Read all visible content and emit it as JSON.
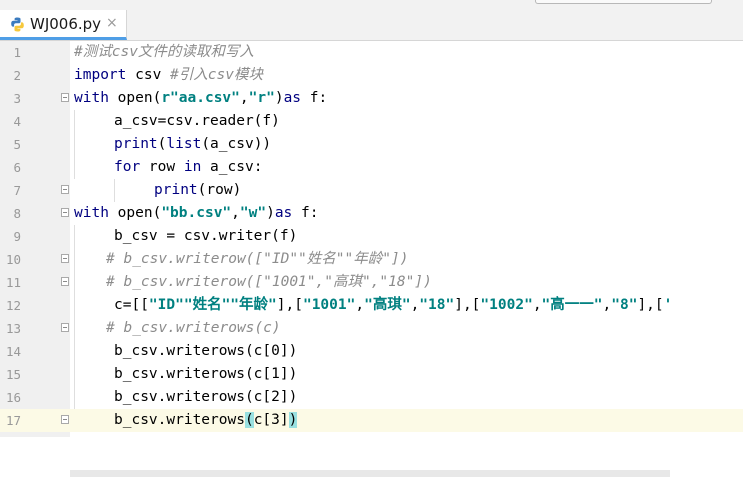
{
  "tab": {
    "filename": "WJ006.py",
    "close": "×"
  },
  "lines": [
    {
      "n": "1",
      "segs": [
        {
          "t": "#测试csv文件的读取和写入",
          "c": "cm"
        }
      ]
    },
    {
      "n": "2",
      "segs": [
        {
          "t": "import",
          "c": "kw"
        },
        {
          "t": " csv ",
          "c": ""
        },
        {
          "t": "#引入csv模块",
          "c": "cm"
        }
      ]
    },
    {
      "n": "3",
      "segs": [
        {
          "t": "with",
          "c": "kw"
        },
        {
          "t": " open(",
          "c": ""
        },
        {
          "t": "r\"aa.csv\"",
          "c": "str"
        },
        {
          "t": ",",
          "c": ""
        },
        {
          "t": "\"r\"",
          "c": "str"
        },
        {
          "t": ")",
          "c": ""
        },
        {
          "t": "as",
          "c": "kw"
        },
        {
          "t": " f:",
          "c": ""
        }
      ]
    },
    {
      "n": "4",
      "segs": [
        {
          "t": "a_csv=csv.reader(f)",
          "c": ""
        }
      ]
    },
    {
      "n": "5",
      "segs": [
        {
          "t": "print",
          "c": "bi"
        },
        {
          "t": "(",
          "c": ""
        },
        {
          "t": "list",
          "c": "bi"
        },
        {
          "t": "(a_csv))",
          "c": ""
        }
      ]
    },
    {
      "n": "6",
      "segs": [
        {
          "t": "for",
          "c": "kw"
        },
        {
          "t": " row ",
          "c": ""
        },
        {
          "t": "in",
          "c": "kw"
        },
        {
          "t": " a_csv:",
          "c": ""
        }
      ]
    },
    {
      "n": "7",
      "segs": [
        {
          "t": "print",
          "c": "bi"
        },
        {
          "t": "(row)",
          "c": ""
        }
      ]
    },
    {
      "n": "8",
      "segs": [
        {
          "t": "with",
          "c": "kw"
        },
        {
          "t": " open(",
          "c": ""
        },
        {
          "t": "\"bb.csv\"",
          "c": "str"
        },
        {
          "t": ",",
          "c": ""
        },
        {
          "t": "\"w\"",
          "c": "str"
        },
        {
          "t": ")",
          "c": ""
        },
        {
          "t": "as",
          "c": "kw"
        },
        {
          "t": " f:",
          "c": ""
        }
      ]
    },
    {
      "n": "9",
      "segs": [
        {
          "t": "b_csv = csv.writer(f)",
          "c": ""
        }
      ]
    },
    {
      "n": "10",
      "segs": [
        {
          "t": "# b_csv.writerow([\"ID\"\"姓名\"\"年龄\"])",
          "c": "cm"
        }
      ]
    },
    {
      "n": "11",
      "segs": [
        {
          "t": "# b_csv.writerow([\"1001\",\"高琪\",\"18\"])",
          "c": "cm"
        }
      ]
    },
    {
      "n": "12",
      "segs": [
        {
          "t": "c=[[",
          "c": ""
        },
        {
          "t": "\"ID\"\"姓名\"\"年龄\"",
          "c": "str"
        },
        {
          "t": "],[",
          "c": ""
        },
        {
          "t": "\"1001\"",
          "c": "str"
        },
        {
          "t": ",",
          "c": ""
        },
        {
          "t": "\"高琪\"",
          "c": "str"
        },
        {
          "t": ",",
          "c": ""
        },
        {
          "t": "\"18\"",
          "c": "str"
        },
        {
          "t": "],[",
          "c": ""
        },
        {
          "t": "\"1002\"",
          "c": "str"
        },
        {
          "t": ",",
          "c": ""
        },
        {
          "t": "\"高一一\"",
          "c": "str"
        },
        {
          "t": ",",
          "c": ""
        },
        {
          "t": "\"8\"",
          "c": "str"
        },
        {
          "t": "],[",
          "c": ""
        },
        {
          "t": "'",
          "c": "str"
        }
      ]
    },
    {
      "n": "13",
      "segs": [
        {
          "t": "# b_csv.writerows(c)",
          "c": "cm"
        }
      ]
    },
    {
      "n": "14",
      "segs": [
        {
          "t": "b_csv.writerows(c[0])",
          "c": ""
        }
      ]
    },
    {
      "n": "15",
      "segs": [
        {
          "t": "b_csv.writerows(c[1])",
          "c": ""
        }
      ]
    },
    {
      "n": "16",
      "segs": [
        {
          "t": "b_csv.writerows(c[2])",
          "c": ""
        }
      ]
    },
    {
      "n": "17",
      "segs": [
        {
          "t": "b_csv.writerows",
          "c": ""
        },
        {
          "t": "(",
          "c": "hl"
        },
        {
          "t": "c[3]",
          "c": ""
        },
        {
          "t": ")",
          "c": "hl"
        }
      ]
    }
  ]
}
